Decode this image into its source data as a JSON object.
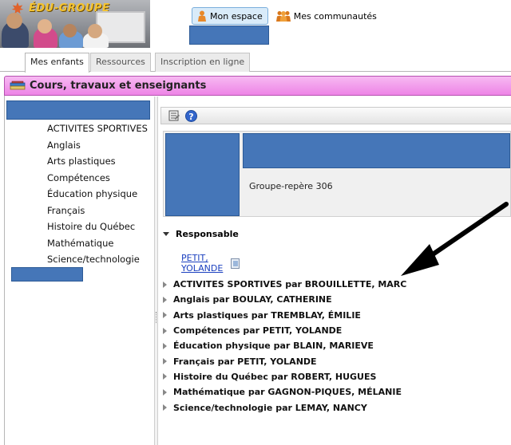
{
  "header": {
    "brand": "ÉDU-GROUPE",
    "nav": [
      {
        "label": "Mon espace",
        "active": true,
        "icon": "person-icon"
      },
      {
        "label": "Mes communautés",
        "active": false,
        "icon": "community-icon"
      }
    ]
  },
  "tabs": [
    {
      "label": "Mes enfants",
      "active": true
    },
    {
      "label": "Ressources",
      "active": false
    },
    {
      "label": "Inscription en ligne",
      "active": false
    }
  ],
  "panel": {
    "title": "Cours, travaux et enseignants",
    "icon": "books-icon"
  },
  "subjects": [
    "ACTIVITES SPORTIVES",
    "Anglais",
    "Arts plastiques",
    "Compétences",
    "Éducation physique",
    "Français",
    "Histoire du Québec",
    "Mathématique",
    "Science/technologie"
  ],
  "toolbar": {
    "icons": [
      "notes-icon",
      "help-icon"
    ],
    "help_glyph": "?"
  },
  "info": {
    "group": "Groupe-repère 306"
  },
  "responsable": {
    "label": "Responsable",
    "name": "PETIT, YOLANDE"
  },
  "courses": [
    "ACTIVITES SPORTIVES par BROUILLETTE, MARC",
    "Anglais par BOULAY, CATHERINE",
    "Arts plastiques par TREMBLAY, ÉMILIE",
    "Compétences par PETIT, YOLANDE",
    "Éducation physique par BLAIN, MARIEVE",
    "Français par PETIT, YOLANDE",
    "Histoire du Québec par ROBERT, HUGUES",
    "Mathématique par GAGNON-PIQUES, MÉLANIE",
    "Science/technologie par LEMAY, NANCY"
  ],
  "colors": {
    "panel_header": "#ed84e6",
    "redaction": "#4576b8",
    "link": "#1a3fbf",
    "active_nav": "#d9ebf9"
  }
}
